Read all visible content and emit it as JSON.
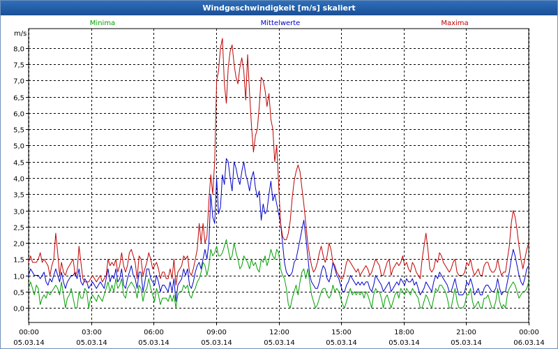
{
  "window": {
    "title": "Windgeschwindigkeit [m/s] skaliert"
  },
  "chart_data": {
    "type": "line",
    "title": "Windgeschwindigkeit [m/s] skaliert",
    "ylabel": "m/s",
    "xlabel": "",
    "ylim": [
      -0.45,
      8.6
    ],
    "y_ticks": [
      "0,0",
      "0,5",
      "1,0",
      "1,5",
      "2,0",
      "2,5",
      "3,0",
      "3,5",
      "4,0",
      "4,5",
      "5,0",
      "5,5",
      "6,0",
      "6,5",
      "7,0",
      "7,5",
      "8,0"
    ],
    "xlim": [
      0,
      24
    ],
    "x_ticks": [
      {
        "time": "00:00",
        "date": "05.03.14"
      },
      {
        "time": "03:00",
        "date": "05.03.14"
      },
      {
        "time": "06:00",
        "date": "05.03.14"
      },
      {
        "time": "09:00",
        "date": "05.03.14"
      },
      {
        "time": "12:00",
        "date": "05.03.14"
      },
      {
        "time": "15:00",
        "date": "05.03.14"
      },
      {
        "time": "18:00",
        "date": "05.03.14"
      },
      {
        "time": "21:00",
        "date": "05.03.14"
      },
      {
        "time": "00:00",
        "date": "06.03.14"
      }
    ],
    "grid": true,
    "colors": {
      "minima": "#00a000",
      "mittelwerte": "#0000c8",
      "maxima": "#c00000"
    },
    "series": [
      {
        "name": "Minima",
        "key": "minima",
        "values": [
          0.6,
          0.8,
          0.6,
          0.4,
          0.7,
          0.6,
          0.1,
          0.3,
          0.4,
          0.3,
          0.5,
          0.4,
          0.5,
          0.6,
          0.7,
          0.6,
          0.4,
          0.8,
          0.4,
          0.0,
          0.3,
          0.4,
          0.6,
          0.3,
          0.0,
          0.0,
          0.5,
          0.3,
          0.3,
          0.6,
          0.5,
          0.0,
          0.3,
          0.4,
          0.3,
          0.2,
          0.4,
          0.3,
          0.2,
          0.4,
          0.6,
          0.8,
          0.5,
          0.7,
          0.5,
          0.9,
          0.6,
          0.7,
          0.9,
          0.4,
          0.3,
          0.6,
          0.7,
          0.8,
          0.7,
          0.6,
          0.3,
          0.7,
          0.6,
          0.2,
          0.5,
          0.6,
          0.9,
          0.6,
          0.4,
          0.2,
          0.6,
          0.4,
          0.1,
          0.3,
          0.3,
          0.3,
          0.2,
          0.4,
          0.2,
          0.4,
          0.0,
          0.4,
          0.5,
          0.5,
          0.7,
          0.6,
          0.7,
          0.4,
          0.3,
          0.5,
          0.6,
          0.8,
          0.9,
          1.1,
          1.4,
          1.3,
          1.0,
          1.3,
          1.8,
          1.6,
          1.7,
          1.9,
          1.6,
          1.6,
          1.7,
          1.9,
          2.1,
          1.8,
          1.5,
          1.6,
          2.0,
          1.7,
          1.5,
          1.2,
          1.3,
          1.6,
          1.5,
          1.4,
          1.2,
          1.5,
          1.3,
          1.4,
          1.2,
          1.1,
          1.5,
          1.4,
          1.6,
          1.3,
          1.5,
          1.8,
          1.6,
          1.5,
          1.8,
          1.7,
          1.2,
          1.0,
          0.9,
          0.6,
          0.1,
          0.0,
          0.3,
          0.5,
          0.7,
          0.4,
          0.8,
          1.1,
          1.2,
          0.9,
          1.2,
          0.8,
          0.4,
          0.2,
          0.0,
          0.1,
          0.3,
          0.5,
          0.6,
          0.6,
          0.4,
          0.3,
          0.4,
          0.7,
          0.5,
          0.6,
          0.5,
          0.3,
          0.1,
          0.0,
          0.2,
          0.4,
          0.6,
          0.4,
          0.5,
          0.4,
          0.5,
          0.4,
          0.5,
          0.3,
          0.5,
          0.4,
          0.2,
          0.0,
          0.4,
          0.6,
          0.5,
          0.5,
          0.3,
          0.0,
          0.3,
          0.4,
          0.2,
          0.0,
          0.2,
          0.4,
          0.5,
          0.3,
          0.6,
          0.5,
          0.4,
          0.6,
          0.5,
          0.4,
          0.6,
          0.5,
          0.4,
          0.3,
          0.0,
          0.0,
          0.2,
          0.4,
          0.3,
          0.1,
          0.0,
          0.3,
          0.6,
          0.5,
          0.7,
          0.7,
          0.6,
          0.5,
          0.3,
          0.0,
          0.0,
          0.3,
          0.6,
          0.2,
          0.0,
          0.0,
          0.0,
          0.1,
          0.4,
          0.4,
          0.6,
          0.2,
          0.0,
          0.1,
          0.2,
          0.0,
          0.0,
          0.3,
          0.3,
          0.4,
          0.2,
          0.0,
          0.0,
          0.2,
          0.6,
          0.2,
          0.0,
          0.1,
          0.0,
          0.4,
          0.6,
          0.7,
          0.8,
          0.7,
          0.5,
          0.3,
          0.4,
          0.5,
          0.5,
          0.6,
          0.8
        ]
      },
      {
        "name": "Mittelwerte",
        "key": "mittelwerte",
        "values": [
          1.0,
          1.2,
          1.1,
          1.0,
          1.0,
          1.0,
          0.9,
          1.0,
          1.1,
          0.8,
          0.7,
          0.9,
          0.8,
          1.0,
          1.2,
          1.0,
          0.8,
          1.1,
          0.8,
          0.6,
          0.8,
          0.9,
          1.0,
          1.0,
          1.1,
          0.9,
          1.2,
          0.8,
          0.7,
          0.9,
          0.8,
          0.6,
          0.7,
          0.8,
          0.7,
          0.6,
          0.7,
          0.8,
          0.7,
          0.6,
          0.9,
          1.2,
          0.8,
          1.0,
          0.9,
          1.2,
          0.8,
          0.9,
          1.2,
          0.7,
          0.6,
          0.9,
          1.1,
          1.3,
          1.0,
          0.9,
          0.6,
          1.1,
          1.1,
          0.5,
          0.8,
          1.2,
          1.2,
          0.9,
          0.8,
          0.7,
          1.0,
          0.8,
          0.5,
          0.7,
          0.7,
          0.6,
          0.5,
          0.8,
          0.5,
          0.9,
          0.2,
          0.7,
          0.8,
          0.9,
          1.2,
          1.0,
          1.2,
          0.7,
          0.6,
          0.8,
          1.1,
          1.3,
          1.4,
          1.2,
          1.5,
          1.8,
          1.5,
          2.0,
          3.5,
          2.8,
          2.6,
          4.0,
          2.9,
          3.1,
          4.1,
          3.8,
          4.6,
          4.5,
          4.0,
          3.6,
          4.5,
          4.3,
          4.0,
          3.8,
          4.2,
          4.5,
          4.1,
          3.9,
          3.6,
          4.0,
          4.2,
          3.7,
          3.4,
          3.6,
          2.7,
          3.2,
          2.9,
          3.0,
          3.5,
          3.9,
          3.3,
          3.5,
          3.2,
          2.9,
          2.6,
          2.0,
          1.4,
          1.1,
          1.0,
          1.0,
          1.1,
          1.4,
          1.5,
          1.8,
          2.1,
          2.4,
          2.7,
          2.2,
          1.6,
          1.0,
          0.8,
          0.7,
          0.6,
          0.6,
          0.8,
          1.1,
          1.3,
          1.2,
          0.9,
          0.8,
          1.0,
          1.4,
          1.2,
          1.0,
          0.9,
          0.7,
          0.5,
          0.5,
          0.7,
          0.8,
          1.0,
          0.9,
          0.8,
          0.7,
          0.8,
          0.7,
          0.8,
          0.7,
          0.8,
          0.8,
          0.6,
          0.5,
          0.7,
          1.0,
          0.9,
          0.8,
          0.7,
          0.5,
          0.6,
          0.7,
          0.8,
          0.5,
          0.6,
          0.7,
          0.8,
          0.7,
          0.9,
          0.8,
          0.7,
          0.9,
          0.8,
          0.8,
          0.9,
          0.7,
          0.8,
          0.6,
          0.4,
          0.5,
          0.6,
          0.8,
          0.7,
          0.6,
          0.5,
          0.8,
          1.0,
          0.9,
          1.1,
          1.0,
          0.9,
          0.8,
          0.7,
          0.5,
          0.5,
          0.7,
          0.9,
          0.6,
          0.4,
          0.4,
          0.4,
          0.5,
          0.8,
          0.7,
          0.9,
          0.7,
          0.4,
          0.5,
          0.6,
          0.4,
          0.4,
          0.6,
          0.7,
          0.7,
          0.6,
          0.5,
          0.5,
          0.6,
          0.9,
          0.6,
          0.4,
          0.5,
          0.5,
          0.8,
          1.1,
          1.5,
          1.8,
          1.6,
          1.3,
          1.0,
          0.8,
          0.7,
          0.9,
          1.2,
          1.3
        ]
      },
      {
        "name": "Maxima",
        "key": "maxima",
        "values": [
          1.4,
          1.6,
          1.4,
          1.4,
          1.4,
          1.5,
          1.7,
          1.4,
          1.5,
          1.4,
          1.3,
          1.0,
          1.3,
          1.5,
          2.3,
          1.7,
          1.0,
          1.4,
          1.1,
          1.0,
          1.2,
          1.3,
          1.4,
          1.5,
          1.0,
          1.1,
          1.9,
          1.4,
          0.9,
          0.8,
          0.8,
          0.8,
          0.9,
          1.0,
          0.9,
          0.8,
          0.9,
          1.0,
          0.8,
          0.9,
          1.0,
          1.5,
          1.3,
          1.4,
          1.3,
          1.5,
          1.1,
          1.3,
          1.7,
          1.3,
          1.1,
          1.3,
          1.7,
          1.8,
          1.6,
          1.4,
          0.9,
          1.6,
          1.5,
          1.0,
          1.2,
          1.4,
          1.7,
          1.5,
          1.2,
          1.3,
          1.4,
          1.2,
          0.9,
          1.1,
          1.1,
          0.9,
          0.9,
          1.2,
          0.9,
          1.5,
          0.7,
          1.1,
          1.2,
          1.3,
          1.6,
          1.5,
          1.6,
          1.1,
          1.0,
          1.2,
          1.5,
          1.8,
          2.6,
          2.0,
          2.6,
          2.0,
          2.2,
          3.3,
          4.1,
          3.5,
          4.5,
          7.0,
          7.3,
          8.0,
          8.3,
          6.9,
          6.3,
          7.4,
          7.9,
          8.1,
          7.5,
          7.1,
          6.9,
          7.4,
          7.7,
          7.3,
          6.4,
          7.8,
          6.6,
          5.6,
          4.8,
          5.3,
          5.5,
          6.2,
          7.1,
          7.0,
          6.7,
          6.2,
          6.6,
          5.8,
          5.5,
          4.5,
          5.0,
          3.8,
          2.6,
          2.2,
          2.1,
          2.1,
          2.3,
          2.7,
          3.4,
          3.9,
          4.2,
          4.4,
          4.2,
          3.7,
          3.2,
          2.6,
          2.0,
          1.6,
          1.3,
          1.1,
          1.2,
          1.4,
          1.7,
          1.9,
          1.6,
          1.4,
          1.6,
          2.0,
          1.8,
          1.4,
          1.3,
          1.1,
          1.0,
          0.9,
          0.9,
          1.1,
          1.4,
          1.5,
          1.4,
          1.3,
          1.2,
          1.1,
          1.2,
          1.0,
          1.1,
          1.2,
          1.3,
          1.2,
          1.0,
          1.1,
          1.3,
          1.5,
          1.4,
          1.3,
          1.0,
          1.0,
          1.2,
          1.4,
          1.5,
          1.0,
          1.2,
          1.3,
          1.4,
          1.3,
          1.4,
          1.6,
          1.3,
          1.4,
          1.2,
          1.1,
          1.4,
          1.3,
          1.1,
          1.0,
          0.9,
          1.5,
          1.9,
          2.3,
          1.8,
          1.2,
          1.1,
          1.2,
          1.5,
          1.4,
          1.7,
          1.6,
          1.4,
          1.3,
          1.2,
          1.1,
          1.2,
          1.4,
          1.5,
          1.1,
          1.0,
          1.0,
          1.0,
          1.1,
          1.4,
          1.3,
          1.5,
          1.2,
          1.0,
          1.1,
          1.2,
          1.0,
          1.0,
          1.3,
          1.4,
          1.4,
          1.2,
          1.1,
          1.1,
          1.2,
          1.5,
          1.2,
          1.0,
          1.1,
          1.1,
          1.5,
          1.9,
          2.6,
          3.0,
          2.8,
          2.4,
          1.9,
          1.5,
          1.2,
          1.5,
          1.8,
          2.0
        ]
      }
    ]
  }
}
